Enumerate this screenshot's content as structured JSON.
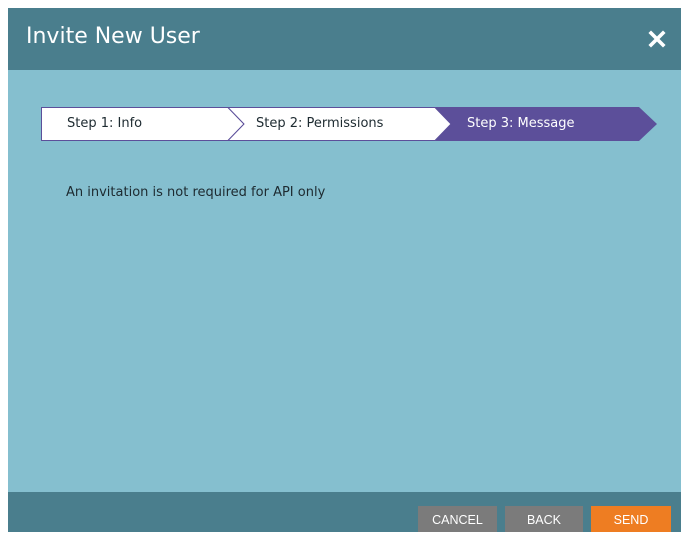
{
  "dialog": {
    "title": "Invite New User",
    "close_icon": "close-icon"
  },
  "steps": [
    {
      "label": "Step 1: Info",
      "state": "complete"
    },
    {
      "label": "Step 2: Permissions",
      "state": "complete"
    },
    {
      "label": "Step 3: Message",
      "state": "active"
    }
  ],
  "content": {
    "message": "An invitation is not required for API only"
  },
  "footer": {
    "cancel_label": "CANCEL",
    "back_label": "BACK",
    "send_label": "SEND"
  },
  "colors": {
    "header_bg": "#4a7e8d",
    "body_bg": "#85bfcf",
    "active_step": "#5c4f9a",
    "send_button": "#ee7d22",
    "secondary_button": "#7b7b7b"
  }
}
